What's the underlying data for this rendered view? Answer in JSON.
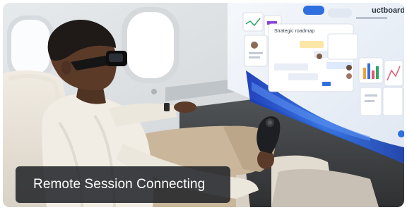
{
  "caption": {
    "text": "Remote Session Connecting"
  },
  "virtual_screen": {
    "title": "uctboard",
    "panel_heading": "Strategic roadmap"
  },
  "colors": {
    "caption_bg": "#1c1e22",
    "caption_text": "#ffffff",
    "accent_blue": "#2f6fe0",
    "wallpaper_blue": "#1f47c8"
  },
  "icons": [
    "airplane-window-icon",
    "ar-glasses-icon",
    "controller-icon",
    "bar-chart-icon"
  ]
}
